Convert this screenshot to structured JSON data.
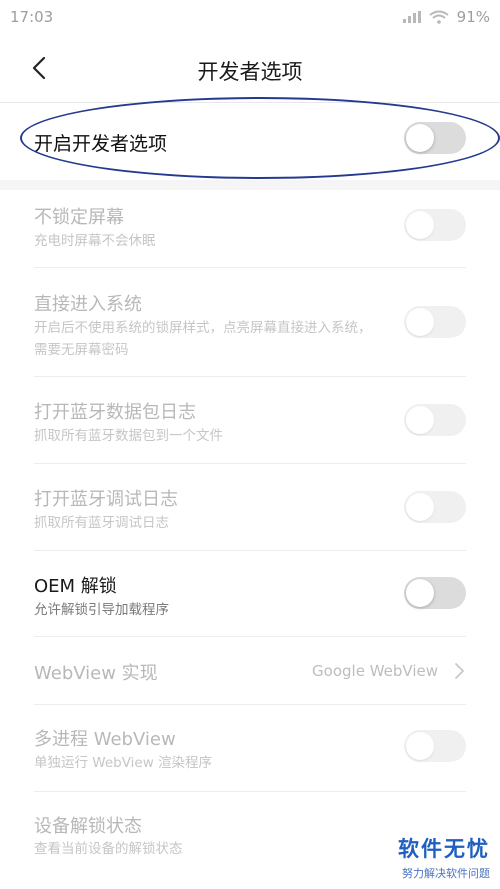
{
  "status_bar": {
    "time": "17:03",
    "battery": "91%"
  },
  "header": {
    "title": "开发者选项"
  },
  "master_toggle": {
    "label": "开启开发者选项",
    "state": "off"
  },
  "settings": [
    {
      "label": "不锁定屏幕",
      "subtitle": "充电时屏幕不会休眠",
      "state": "off"
    },
    {
      "label": "直接进入系统",
      "subtitle": "开启后不使用系统的锁屏样式，点亮屏幕直接进入系统，需要无屏幕密码",
      "state": "off"
    },
    {
      "label": "打开蓝牙数据包日志",
      "subtitle": "抓取所有蓝牙数据包到一个文件",
      "state": "off"
    },
    {
      "label": "打开蓝牙调试日志",
      "subtitle": "抓取所有蓝牙调试日志",
      "state": "off"
    },
    {
      "label": "OEM 解锁",
      "subtitle": "允许解锁引导加载程序",
      "state": "off"
    },
    {
      "label": "WebView 实现",
      "value": "Google WebView"
    },
    {
      "label": "多进程 WebView",
      "subtitle": "单独运行 WebView 渲染程序",
      "state": "off"
    },
    {
      "label": "设备解锁状态",
      "subtitle": "查看当前设备的解锁状态"
    }
  ],
  "watermark": {
    "title": "软件无忧",
    "subtitle": "努力解决软件问题"
  },
  "colors": {
    "annotation": "#243a8f",
    "watermark": "#1f5fbf"
  }
}
